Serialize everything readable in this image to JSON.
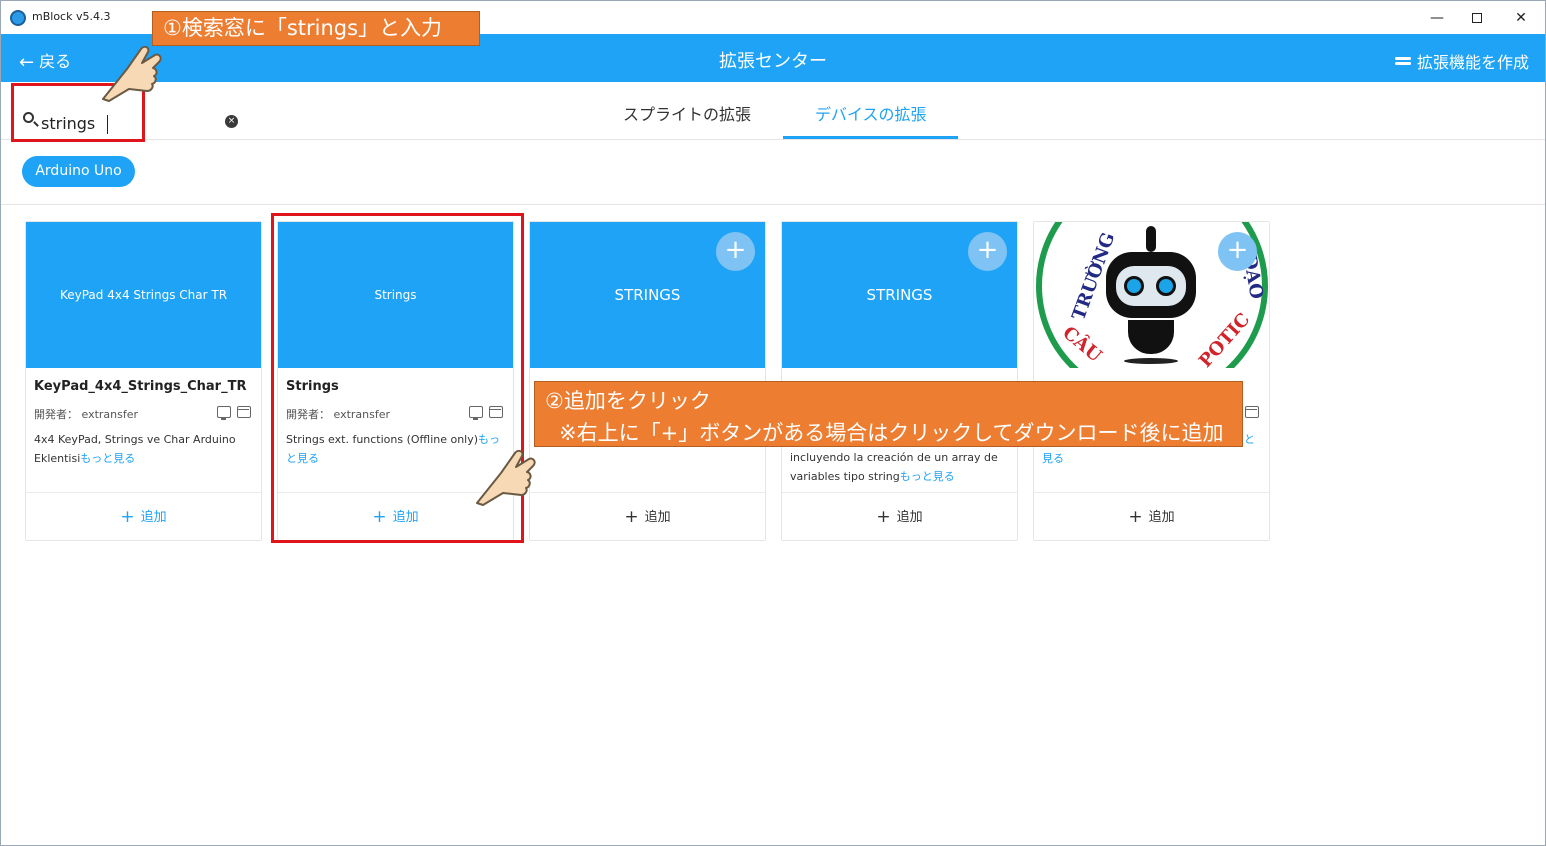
{
  "window": {
    "app_title": "mBlock v5.4.3",
    "minimize_glyph": "—",
    "close_glyph": "✕"
  },
  "header": {
    "back_label": "戻る",
    "title": "拡張センター",
    "create_label": "拡張機能を作成"
  },
  "search": {
    "value": "strings",
    "clear_glyph": "×"
  },
  "tabs": [
    {
      "label": "スプライトの拡張",
      "active": false
    },
    {
      "label": "デバイスの拡張",
      "active": true
    }
  ],
  "filter_chip": "Arduino Uno",
  "cards": [
    {
      "banner": "KeyPad 4x4 Strings Char TR",
      "name": "KeyPad_4x4_Strings_Char_TR",
      "author": "開発者：  extransfer",
      "desc": "4x4 KeyPad, Strings ve Char Arduino Eklentisi",
      "more": "もっと見る",
      "add_label": "追加"
    },
    {
      "banner": "Strings",
      "name": "Strings",
      "author": "開発者：  extransfer",
      "desc": "Strings ext. functions (Offline only)",
      "more": "もっと見る",
      "add_label": "追加"
    },
    {
      "banner": "STRINGS",
      "add_label": "追加"
    },
    {
      "banner": "STRINGS",
      "desc": "incluyendo la creación de un array de variables tipo string",
      "more": "もっと見る",
      "add_label": "追加"
    },
    {
      "ring_top": "TRƯỜNG",
      "ring_right": "ĐẠO",
      "ring_bottom": "CÂU",
      "ring_bottom_right": "POTIC",
      "more_fragment": "と",
      "more_fragment_2": "見る",
      "add_label": "追加"
    }
  ],
  "plus_glyph": "+",
  "annotations": {
    "step1": "①検索窓に「strings」と入力",
    "step2_line1": "②追加をクリック",
    "step2_line2": "※右上に「+」ボタンがある場合はクリックしてダウンロード後に追加"
  },
  "colors": {
    "brand_blue": "#1fa3f6",
    "callout_orange": "#ed7d31",
    "highlight_red": "#e0141b"
  },
  "icons": [
    "app-logo-icon",
    "back-arrow-icon",
    "create-extension-icon",
    "search-icon",
    "clear-icon",
    "pc-icon",
    "web-icon",
    "plus-icon",
    "pointing-hand-icon"
  ]
}
